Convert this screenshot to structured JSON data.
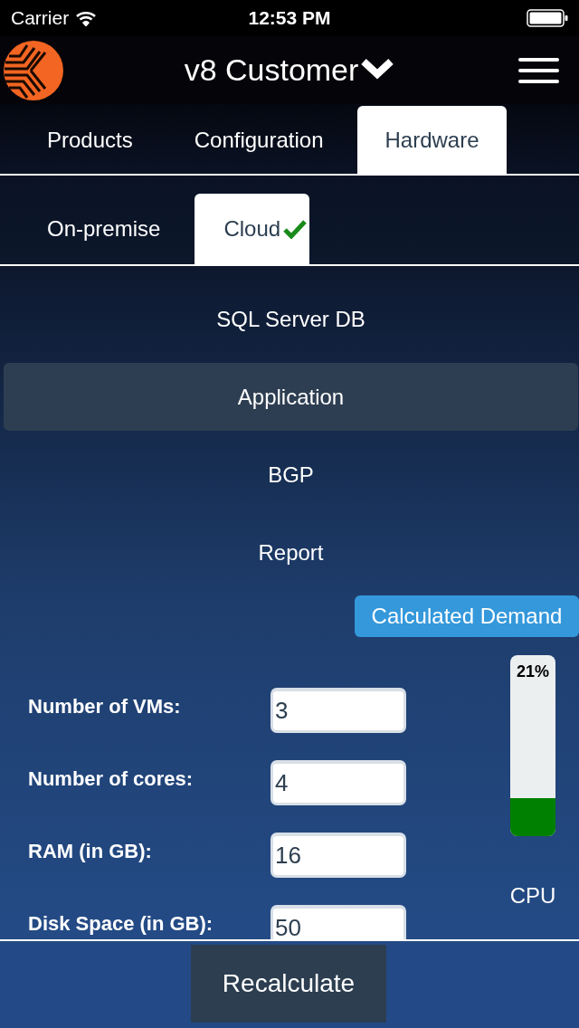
{
  "status_bar": {
    "carrier": "Carrier",
    "time": "12:53 PM"
  },
  "header": {
    "title": "v8 Customer"
  },
  "tabs": [
    {
      "label": "Products",
      "selected": false
    },
    {
      "label": "Configuration",
      "selected": false
    },
    {
      "label": "Hardware",
      "selected": true
    }
  ],
  "sub_tabs": [
    {
      "label": "On-premise",
      "selected": false,
      "checked": false
    },
    {
      "label": "Cloud",
      "selected": true,
      "checked": true
    }
  ],
  "menu": [
    {
      "label": "SQL Server DB",
      "selected": false
    },
    {
      "label": "Application",
      "selected": true
    },
    {
      "label": "BGP",
      "selected": false
    },
    {
      "label": "Report",
      "selected": false
    }
  ],
  "demand": {
    "title": "Calculated Demand",
    "fields": [
      {
        "label": "Number of VMs:",
        "value": "3"
      },
      {
        "label": "Number of cores:",
        "value": "4"
      },
      {
        "label": "RAM (in GB):",
        "value": "16"
      },
      {
        "label": "Disk Space (in GB):",
        "value": "50"
      }
    ],
    "gauge": {
      "reading": "21%",
      "level": 0.21,
      "label": "CPU"
    }
  },
  "footer": {
    "button": "Recalculate"
  }
}
